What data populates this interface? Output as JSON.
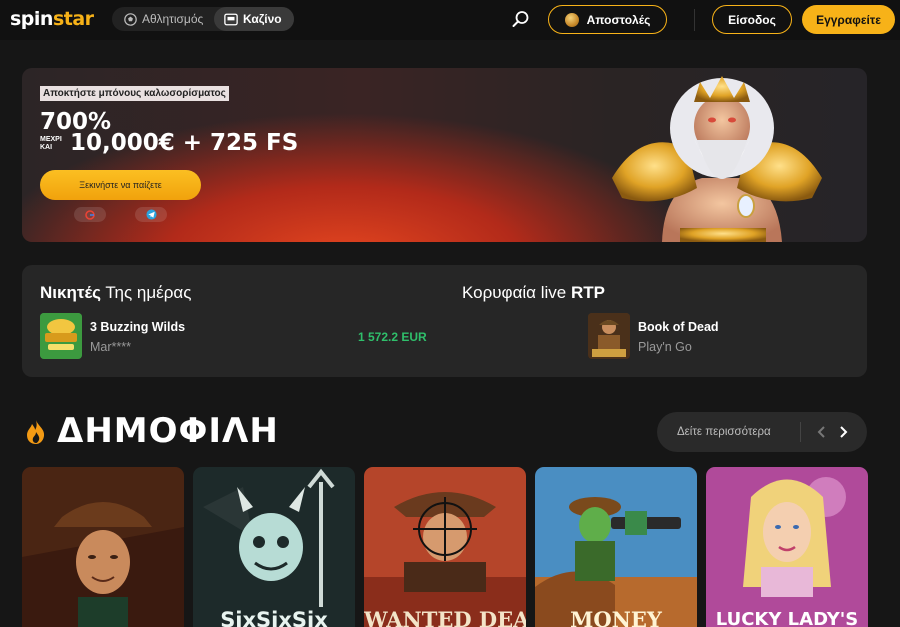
{
  "header": {
    "logo_spin": "spin",
    "logo_star": "star",
    "nav": [
      {
        "label": "Αθλητισμός",
        "icon": "soccer-ball-icon"
      },
      {
        "label": "Καζίνο",
        "icon": "slot-machine-icon"
      }
    ],
    "missions_label": "Αποστολές",
    "login_label": "Είσοδος",
    "register_label": "Εγγραφείτε",
    "accent_color": "#f7b218"
  },
  "banner": {
    "tag": "Αποκτήστε μπόνους καλωσορίσματος",
    "percent": "700%",
    "upto": "ΜΕΧΡΙ ΚΑΙ",
    "amount": "10,000€ + 725 FS",
    "cta_label": "Ξεκινήστε να παίζετε",
    "socials": [
      "google-icon",
      "telegram-icon"
    ]
  },
  "winners": {
    "title_bold": "Νικητές",
    "title_rest": "Της ημέρας",
    "game": "3 Buzzing Wilds",
    "player": "Mar****",
    "amount": "1 572.2 EUR"
  },
  "top_rtp": {
    "title_plain": "Κορυφαία live",
    "title_bold": "RTP",
    "game": "Book of Dead",
    "provider": "Play'n Go"
  },
  "popular": {
    "title": "ΔΗΜΟΦΙΛΗ",
    "see_more_label": "Δείτε περισσότερα",
    "tiles": [
      {
        "label": ""
      },
      {
        "label": "SixSixSix"
      },
      {
        "label": "WANTED DEAD"
      },
      {
        "label": "MONEY"
      },
      {
        "label": "LUCKY LADY'S"
      }
    ]
  }
}
